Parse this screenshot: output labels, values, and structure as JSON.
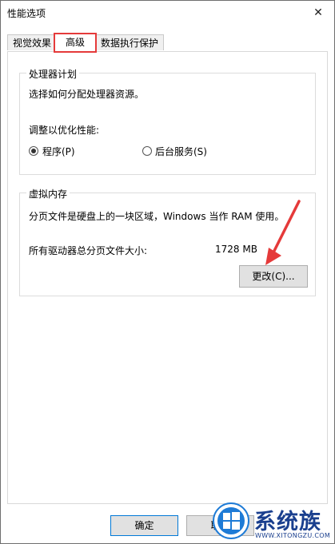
{
  "window": {
    "title": "性能选项",
    "close_glyph": "✕"
  },
  "tabs": [
    {
      "label": "视觉效果",
      "active": false
    },
    {
      "label": "高级",
      "active": true
    },
    {
      "label": "数据执行保护",
      "active": false
    }
  ],
  "processor_scheduling": {
    "legend": "处理器计划",
    "description": "选择如何分配处理器资源。",
    "adjust_label": "调整以优化性能:",
    "options": [
      {
        "label": "程序(P)",
        "selected": true
      },
      {
        "label": "后台服务(S)",
        "selected": false
      }
    ]
  },
  "virtual_memory": {
    "legend": "虚拟内存",
    "description": "分页文件是硬盘上的一块区域，Windows 当作 RAM 使用。",
    "total_label": "所有驱动器总分页文件大小:",
    "total_value": "1728 MB",
    "change_button": "更改(C)..."
  },
  "footer": {
    "ok_button": "确定",
    "cancel_button": "取消"
  },
  "annotation": {
    "highlight_color": "#e53a3a"
  },
  "watermark": {
    "text": "系统族",
    "url": "WWW.XITONGZU.COM",
    "colors": {
      "brand": "#1a3f8e",
      "logo": "#1e7bd6"
    }
  }
}
